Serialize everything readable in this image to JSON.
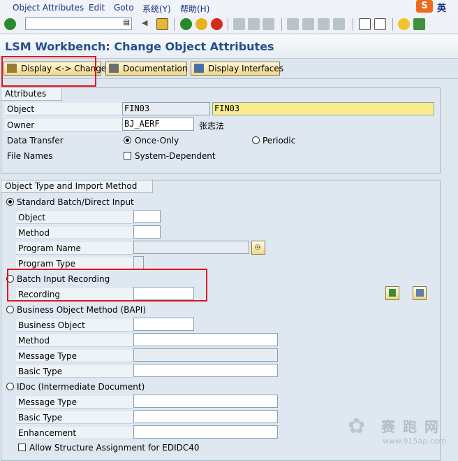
{
  "menu": [
    "Object Attributes",
    "Edit",
    "Goto",
    "系统(Y)",
    "帮助(H)"
  ],
  "ime": {
    "label": "英"
  },
  "title": "LSM Workbench: Change Object Attributes",
  "app_toolbar": {
    "display_change": "Display <-> Change",
    "documentation": "Documentation",
    "display_interfaces": "Display Interfaces"
  },
  "attributes": {
    "title": "Attributes",
    "object_label": "Object",
    "object_value": "FIN03",
    "object_desc": "FIN03",
    "owner_label": "Owner",
    "owner_value": "BJ_AERF",
    "owner_name": "张志法",
    "data_transfer_label": "Data Transfer",
    "once_only": "Once-Only",
    "periodic": "Periodic",
    "file_names_label": "File Names",
    "system_dependent": "System-Dependent"
  },
  "import": {
    "title": "Object Type and Import Method",
    "standard": "Standard Batch/Direct Input",
    "std_object": "Object",
    "std_method": "Method",
    "std_program_name": "Program Name",
    "std_program_type": "Program Type",
    "batch_recording": "Batch Input Recording",
    "recording": "Recording",
    "bapi": "Business Object Method  (BAPI)",
    "bapi_object": "Business Object",
    "bapi_method": "Method",
    "bapi_message_type": "Message Type",
    "bapi_basic_type": "Basic Type",
    "idoc": "IDoc (Intermediate Document)",
    "idoc_message_type": "Message Type",
    "idoc_basic_type": "Basic Type",
    "idoc_enhancement": "Enhancement",
    "allow_structure": "Allow Structure Assignment for EDIDC40"
  },
  "watermark": {
    "cn": "赛 跑 网",
    "url": "www.915ap.com"
  },
  "colors": {
    "title": "#254f86",
    "highlight": "#e0141e",
    "required": "#fbec8c"
  }
}
